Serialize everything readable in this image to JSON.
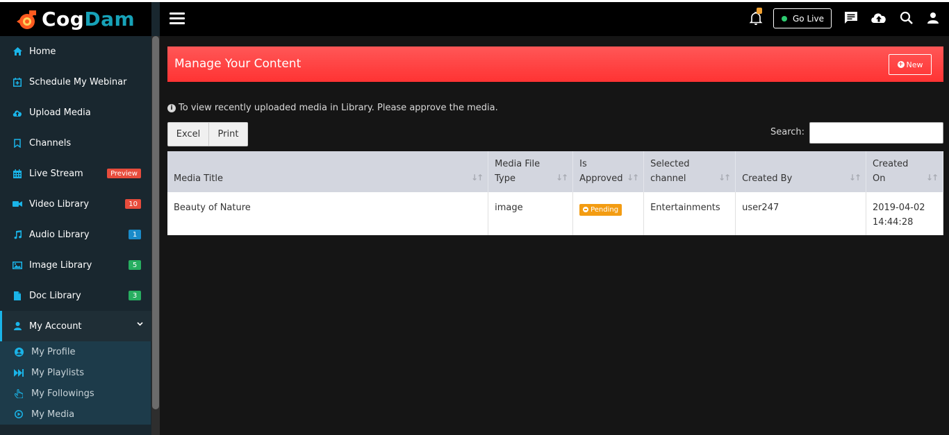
{
  "app": {
    "logo_part1": "Cog",
    "logo_part2": "Dam"
  },
  "colors": {
    "accent": "#1ab4e8",
    "banner": "#ff4444",
    "badge_red": "#e74c3c",
    "badge_blue": "#1a8bc9",
    "badge_green": "#27ae60",
    "pending": "#f39c12"
  },
  "sidebar": {
    "items": [
      {
        "label": "Home",
        "icon": "home-icon"
      },
      {
        "label": "Schedule My Webinar",
        "icon": "calendar-plus-icon"
      },
      {
        "label": "Upload Media",
        "icon": "cloud-upload-icon"
      },
      {
        "label": "Channels",
        "icon": "bookmark-icon"
      },
      {
        "label": "Live Stream",
        "icon": "calendar-icon",
        "badge": "Preview"
      },
      {
        "label": "Video Library",
        "icon": "video-camera-icon",
        "badge": "10"
      },
      {
        "label": "Audio Library",
        "icon": "music-note-icon",
        "badge": "1"
      },
      {
        "label": "Image Library",
        "icon": "image-icon",
        "badge": "5"
      },
      {
        "label": "Doc Library",
        "icon": "document-icon",
        "badge": "3"
      },
      {
        "label": "My Account",
        "icon": "user-icon"
      }
    ],
    "subitems": [
      {
        "label": "My Profile",
        "icon": "user-circle-icon"
      },
      {
        "label": "My Playlists",
        "icon": "fast-forward-icon"
      },
      {
        "label": "My Followings",
        "icon": "hand-pointer-icon"
      },
      {
        "label": "My Media",
        "icon": "play-circle-icon"
      }
    ]
  },
  "header": {
    "golive_label": "Go Live"
  },
  "main": {
    "title": "Manage Your Content",
    "new_label": "New",
    "info_text": "To view recently uploaded media in Library. Please approve the media.",
    "excel_label": "Excel",
    "print_label": "Print",
    "search_label": "Search:",
    "search_value": ""
  },
  "table": {
    "headers": [
      "Media Title",
      "Media File Type",
      "Is Approved",
      "Selected channel",
      "Created By",
      "Created On"
    ],
    "rows": [
      {
        "title": "Beauty of Nature",
        "type": "image",
        "approved": "Pending",
        "channel": "Entertainments",
        "created_by": "user247",
        "created_on": "2019-04-02 14:44:28"
      }
    ]
  }
}
